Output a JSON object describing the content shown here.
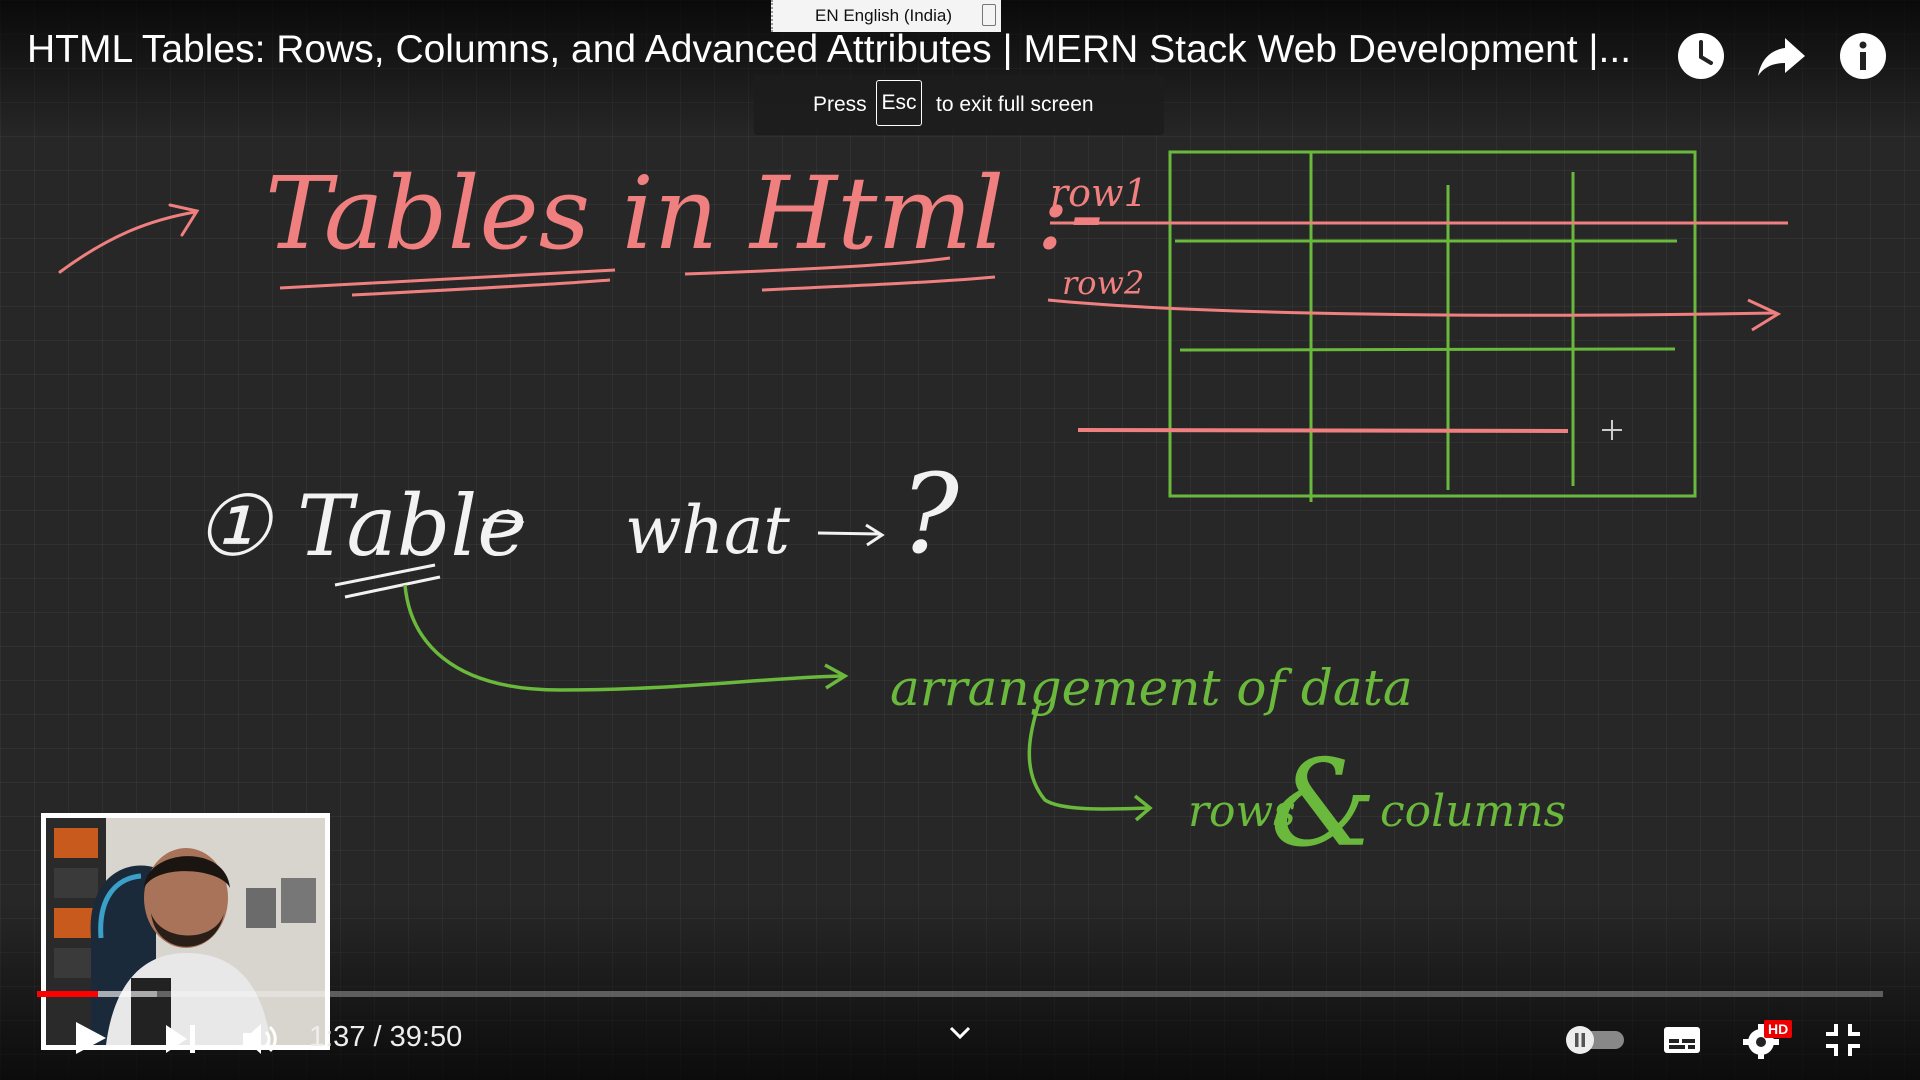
{
  "video": {
    "title": "HTML Tables: Rows, Columns, and Advanced Attributes | MERN Stack Web Development |...",
    "current_time": "1:37",
    "duration": "39:50",
    "time_separator": " / ",
    "progress_fraction": 0.033,
    "buffered_fraction": 0.065
  },
  "top_icons": [
    "watch-later-icon",
    "share-icon",
    "info-icon"
  ],
  "language_indicator": {
    "text": "EN English (India)"
  },
  "fullscreen_notice": {
    "press": "Press",
    "key": "Esc",
    "rest": "to exit full screen"
  },
  "whiteboard": {
    "heading": "Tables in Html :-",
    "table_label": "① Table",
    "question": "what",
    "question_mark": "?",
    "row1_label": "row1",
    "row2_label": "row2",
    "definition": "arrangement of data",
    "detail_rows": "rows",
    "detail_amp": "&",
    "detail_columns": "columns"
  },
  "colors": {
    "accent_red": "#ff0000",
    "pen_pink": "#f08080",
    "pen_green": "#6ab83c",
    "pen_white": "#f2f2f2",
    "board": "#272727"
  },
  "controls": {
    "left": [
      "play-icon",
      "next-icon",
      "volume-icon"
    ],
    "middle": [
      "chevron-down-icon"
    ],
    "right": [
      "autoplay-toggle",
      "subtitles-icon",
      "settings-icon",
      "exit-fullscreen-icon"
    ],
    "quality_badge": "HD"
  }
}
